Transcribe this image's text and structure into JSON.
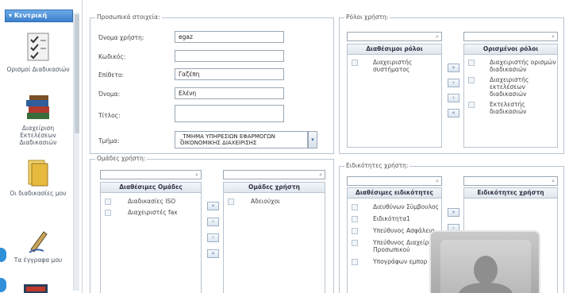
{
  "sidebar": {
    "header": "Κεντρική",
    "items": [
      {
        "label": "Ορισμοί Διαδικασιών",
        "icon": "checklist-icon"
      },
      {
        "label": "Διαχείριση Εκτελέσεων Διαδικασιών",
        "icon": "books-icon"
      },
      {
        "label": "Οι διαδικασίες μου",
        "icon": "folder-icon"
      },
      {
        "label": "Τα έγγραφα μου",
        "icon": "pen-icon"
      }
    ]
  },
  "personal": {
    "title": "Προσωπικά στοιχεία:",
    "username_label": "Όνομα χρήστη:",
    "username_value": "egaz",
    "password_label": "Κωδικός:",
    "password_value": "",
    "surname_label": "Επίθετο:",
    "surname_value": "Γαζέπη",
    "name_label": "Όνομα:",
    "name_value": "Ελένη",
    "titlos_label": "Τίτλος:",
    "titlos_value": "",
    "dept_label": "Τμήμα:",
    "dept_value": "_ΤΜΗΜΑ ΥΠΗΡΕΣΙΩΝ ΕΦΑΡΜΟΓΩΝ ΟΙΚΟΝΟΜΙΚΗΣ ΔΙΑΧΕΙΡΙΣΗΣ"
  },
  "roles": {
    "title": "Ρόλοι χρήστη:",
    "available_header": "Διαθέσιμοι ρόλοι",
    "available": [
      "Διαχειριστής συστήματος"
    ],
    "assigned_header": "Ορισμένοι ρόλοι",
    "assigned": [
      "Διαχειριστής ορισμών διαδικασιών",
      "Διαχειριστής εκτελέσεων διαδικασιών",
      "Εκτελεστής διαδικασιών"
    ]
  },
  "groups": {
    "title": "Ομάδες χρήστη:",
    "available_header": "Διαθέσιμες Ομάδες",
    "available": [
      "Διαδικασίες ISO",
      "Διαχειριστές fax"
    ],
    "assigned_header": "Ομάδες χρήστη",
    "assigned": [
      "Αδειούχοι"
    ]
  },
  "specialties": {
    "title": "Ειδικότητες χρήστη:",
    "available_header": "Διαθέσιμες ειδικότητες",
    "available": [
      "Διευθύνων Σύμβουλος",
      "Ειδικότητα1",
      "Υπεύθυνος Ασφάλεια",
      "Υπεύθυνος Διαχείρι Προσωπικού",
      "Υπογράφων εμπορ"
    ],
    "assigned_header": "Ειδικότητες χρήστη",
    "assigned": []
  },
  "move_buttons": {
    "add": "»",
    "add_one": "›",
    "remove_one": "‹",
    "remove": "«"
  }
}
